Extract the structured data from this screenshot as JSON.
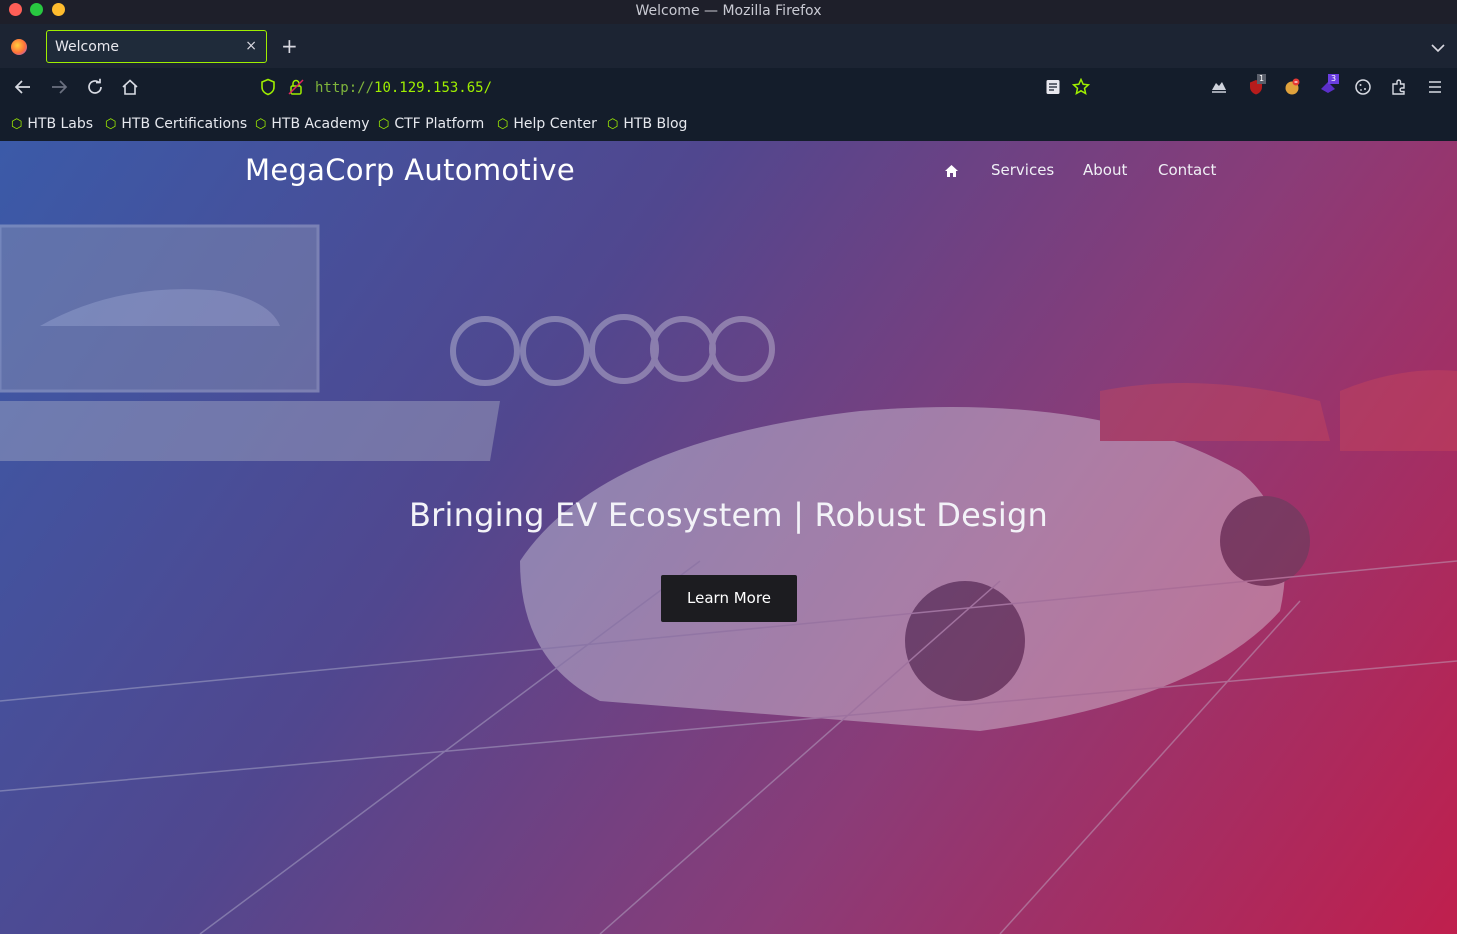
{
  "window": {
    "title": "Welcome — Mozilla Firefox"
  },
  "tabs": [
    {
      "label": "Welcome",
      "close": "×"
    }
  ],
  "new_tab": "+",
  "address_bar": {
    "protocol": "http://",
    "host": "10.129.153.65/"
  },
  "bookmarks": [
    {
      "label": "HTB Labs"
    },
    {
      "label": "HTB Certifications"
    },
    {
      "label": "HTB Academy"
    },
    {
      "label": "CTF Platform"
    },
    {
      "label": "Help Center"
    },
    {
      "label": "HTB Blog"
    }
  ],
  "extensions": {
    "badge_1": "1",
    "badge_2": "3"
  },
  "site": {
    "brand": "MegaCorp Automotive",
    "nav": [
      {
        "label": "Services"
      },
      {
        "label": "About"
      },
      {
        "label": "Contact"
      }
    ],
    "hero_heading": "Bringing EV Ecosystem | Robust Design",
    "cta_label": "Learn More"
  },
  "colors": {
    "accent": "#9fef00",
    "browser_bg": "#141d2b",
    "cta_bg": "#1c1c20"
  }
}
